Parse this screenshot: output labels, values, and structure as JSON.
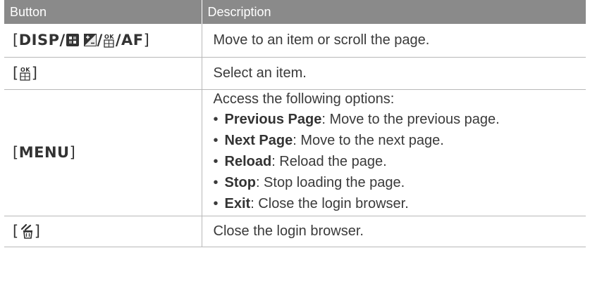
{
  "header": {
    "col_button": "Button",
    "col_description": "Description"
  },
  "rows": [
    {
      "button": {
        "open": "[",
        "disp": "DISP",
        "sep": "/",
        "af": "AF",
        "close": "]"
      },
      "description": "Move to an item or scroll the page."
    },
    {
      "button": {
        "open": "[",
        "close": "]"
      },
      "description": "Select an item."
    },
    {
      "button": {
        "open": "[",
        "menu": "MENU",
        "close": "]"
      },
      "intro": "Access the following options:",
      "options": [
        {
          "name": "Previous Page",
          "text": ": Move to the previous page."
        },
        {
          "name": "Next Page",
          "text": ": Move to the next page."
        },
        {
          "name": "Reload",
          "text": ": Reload the page."
        },
        {
          "name": "Stop",
          "text": ": Stop loading the page."
        },
        {
          "name": "Exit",
          "text": ": Close the login browser."
        }
      ]
    },
    {
      "button": {
        "open": "[",
        "close": "]"
      },
      "description": "Close the login browser."
    }
  ],
  "icons": [
    "flash-icon",
    "exposure-icon",
    "ok-icon",
    "delete-icon"
  ]
}
